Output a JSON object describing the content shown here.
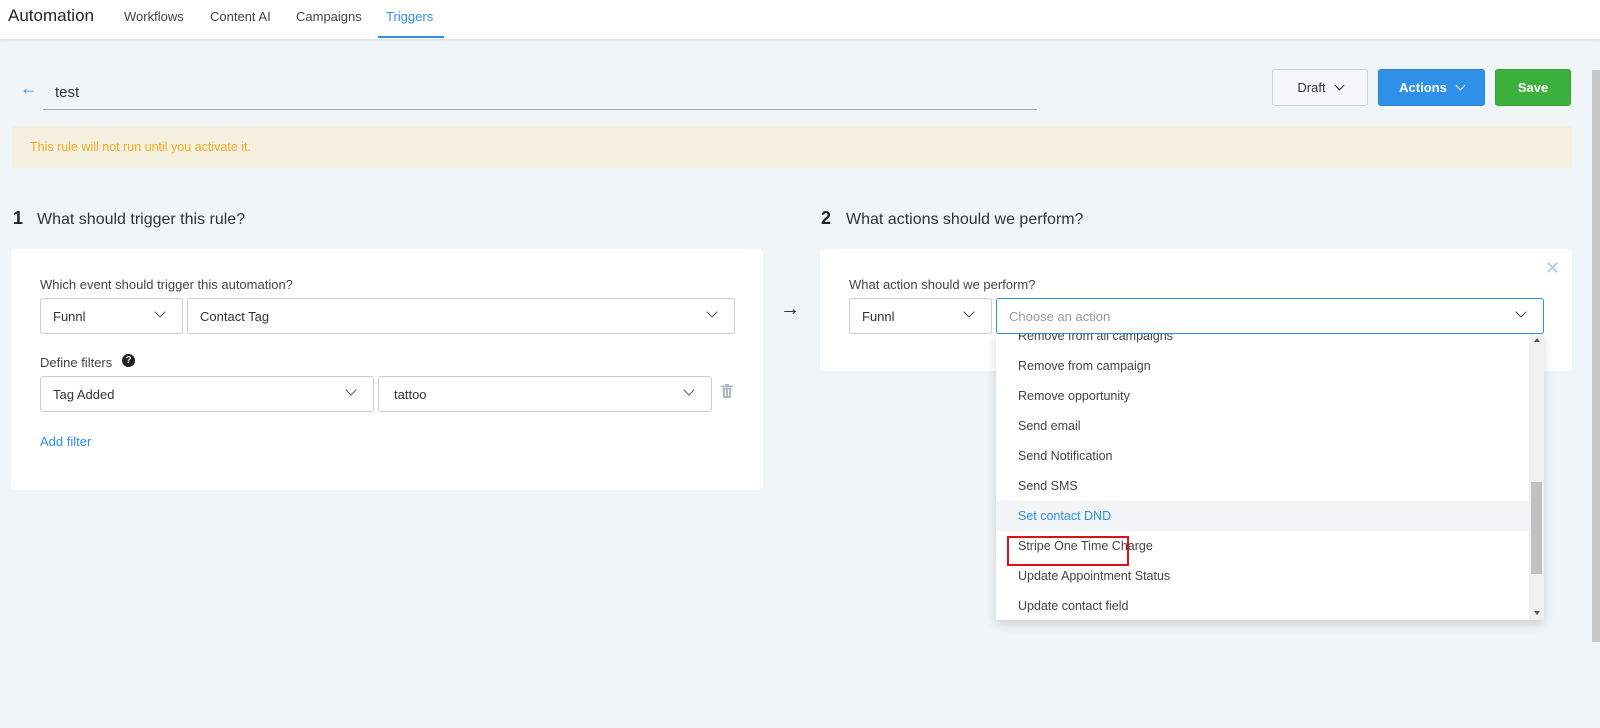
{
  "app": {
    "title": "Automation"
  },
  "nav": {
    "items": [
      "Workflows",
      "Content AI",
      "Campaigns",
      "Triggers"
    ]
  },
  "rule": {
    "name": "test"
  },
  "buttons": {
    "draft": "Draft",
    "actions": "Actions",
    "save": "Save"
  },
  "banner": {
    "text": "This rule will not run until you activate it."
  },
  "step1": {
    "number": "1",
    "title": "What should trigger this rule?",
    "event_label": "Which event should trigger this automation?",
    "source": "Funnl",
    "event": "Contact Tag",
    "filters_label": "Define filters",
    "filter_field": "Tag Added",
    "filter_value": "tattoo",
    "add_filter": "Add filter"
  },
  "step2": {
    "number": "2",
    "title": "What actions should we perform?",
    "action_label": "What action should we perform?",
    "source": "Funnl",
    "action_placeholder": "Choose an action"
  },
  "dropdown": {
    "items": [
      "Remove from all campaigns",
      "Remove from campaign",
      "Remove opportunity",
      "Send email",
      "Send Notification",
      "Send SMS",
      "Set contact DND",
      "Stripe One Time Charge",
      "Update Appointment Status",
      "Update contact field"
    ],
    "hovered": "Set contact DND",
    "highlighted": "Stripe One Time Charge"
  },
  "colors": {
    "accent": "#2e90e8",
    "save": "#3db13d",
    "banner_text": "#f0ad28",
    "highlight": "#e0101a"
  }
}
